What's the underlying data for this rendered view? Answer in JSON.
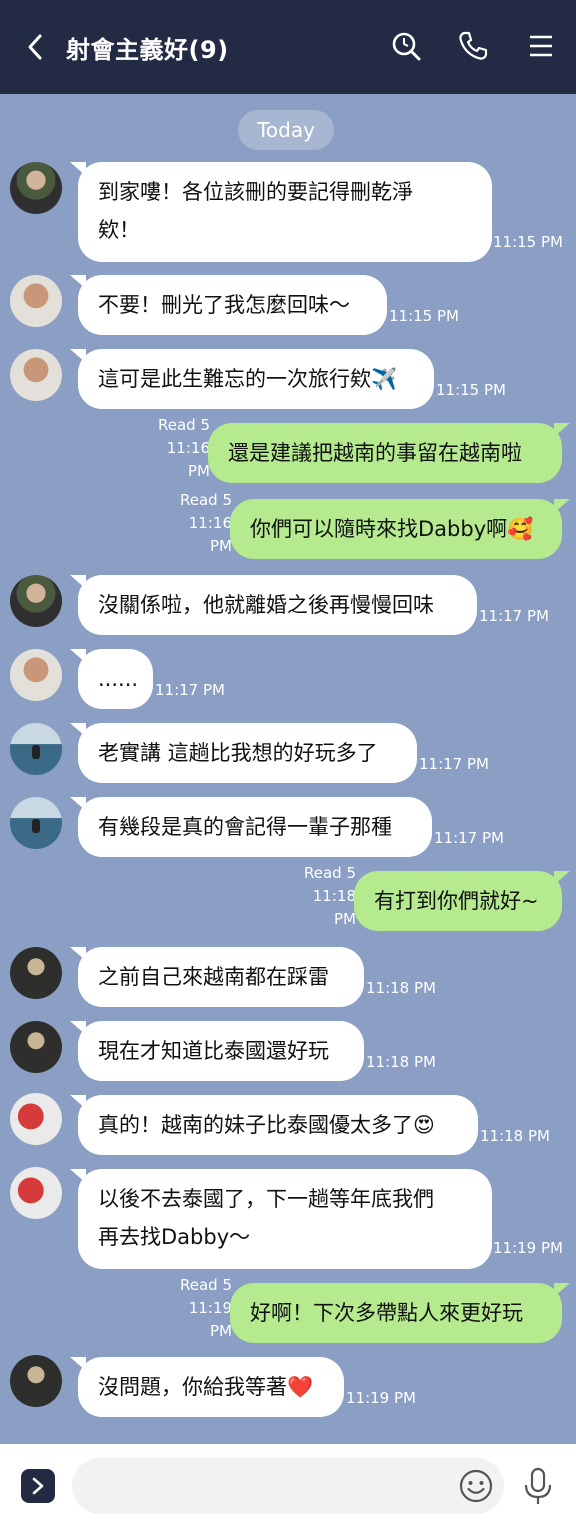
{
  "header": {
    "title": "射會主義好(9)",
    "icons": [
      "chevron-left-icon",
      "search-icon",
      "phone-icon",
      "menu-icon"
    ]
  },
  "chat": {
    "date_label": "Today",
    "messages": [
      {
        "side": "in",
        "line1": "到家嘍！各位該刪的要記得刪乾淨",
        "line2": "欸！",
        "time": "11:15 PM"
      },
      {
        "side": "in",
        "line1": "不要！刪光了我怎麼回味～",
        "time": "11:15 PM"
      },
      {
        "side": "in",
        "line1": "這可是此生難忘的一次旅行欸✈️",
        "time": "11:15 PM"
      },
      {
        "side": "out",
        "line1": "還是建議把越南的事留在越南啦",
        "read": "Read 5",
        "t1": "11:16",
        "t2": "PM"
      },
      {
        "side": "out",
        "line1": "你們可以隨時來找Dabby啊🥰",
        "read": "Read 5",
        "t1": "11:16",
        "t2": "PM"
      },
      {
        "side": "in",
        "line1": "沒關係啦，他就離婚之後再慢慢回味",
        "time": "11:17 PM"
      },
      {
        "side": "in",
        "line1": "......",
        "time": "11:17 PM"
      },
      {
        "side": "in",
        "line1": "老實講 這趟比我想的好玩多了",
        "time": "11:17 PM"
      },
      {
        "side": "in",
        "line1": "有幾段是真的會記得一輩子那種",
        "time": "11:17 PM"
      },
      {
        "side": "out",
        "line1": "有打到你們就好~",
        "read": "Read 5",
        "t1": "11:18",
        "t2": "PM"
      },
      {
        "side": "in",
        "line1": "之前自己來越南都在踩雷",
        "time": "11:18 PM"
      },
      {
        "side": "in",
        "line1": "現在才知道比泰國還好玩",
        "time": "11:18 PM"
      },
      {
        "side": "in",
        "line1": "真的！越南的妹子比泰國優太多了😍",
        "time": "11:18 PM"
      },
      {
        "side": "in",
        "line1": "以後不去泰國了，下一趟等年底我們",
        "line2": "再去找Dabby～",
        "time": "11:19 PM"
      },
      {
        "side": "out",
        "line1": "好啊！下次多帶點人來更好玩",
        "read": "Read 5",
        "t1": "11:19",
        "t2": "PM"
      },
      {
        "side": "in",
        "line1": "沒問題，你給我等著❤️",
        "time": "11:19 PM"
      }
    ]
  },
  "input": {
    "placeholder": "",
    "icons": [
      "expand-icon",
      "emoji-icon",
      "mic-icon"
    ]
  }
}
